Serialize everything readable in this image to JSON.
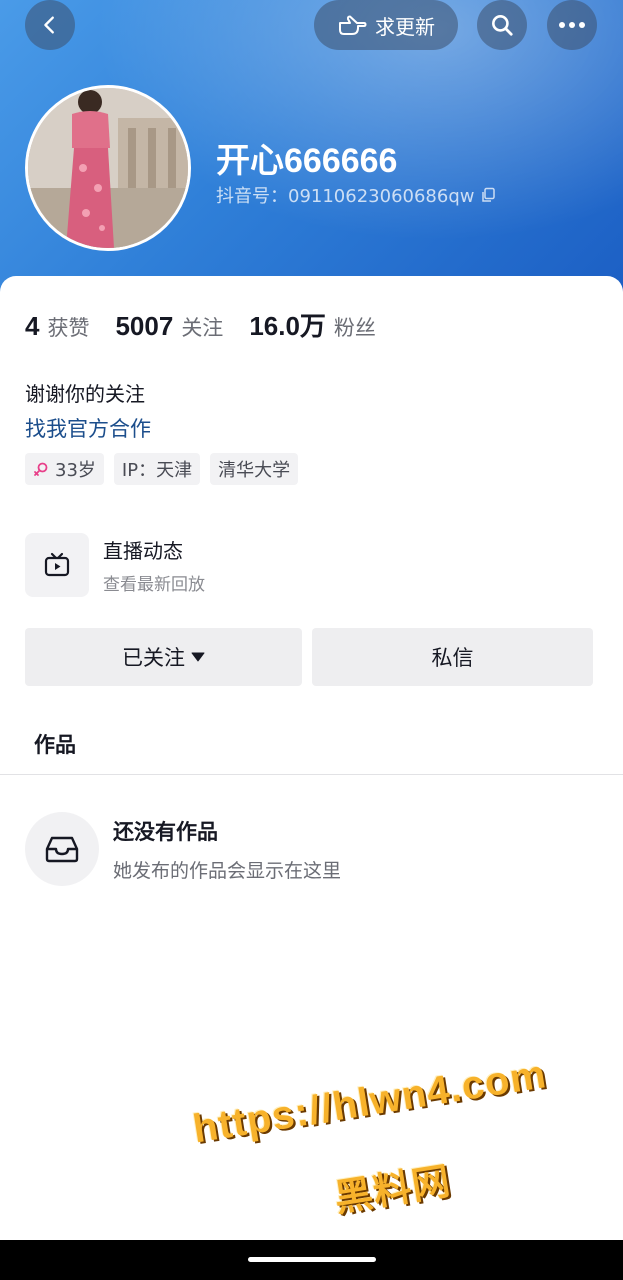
{
  "top_bar": {
    "back_icon": "chevron-left-icon",
    "update_label": "求更新",
    "update_icon": "pointing-hand-icon",
    "search_icon": "search-icon",
    "more_icon": "more-dots-icon"
  },
  "profile": {
    "nickname": "开心666666",
    "douyin_id": "抖音号：09110623060686qw",
    "copy_icon": "copy-icon"
  },
  "stats": [
    {
      "value": "4",
      "label": "获赞"
    },
    {
      "value": "5007",
      "label": "关注"
    },
    {
      "value": "16.0万",
      "label": "粉丝"
    }
  ],
  "bio": "谢谢你的关注",
  "link": "找我官方合作",
  "tags": [
    "33岁",
    "IP：天津",
    "清华大学"
  ],
  "tag_icons": [
    "female-icon"
  ],
  "live": {
    "title": "直播动态",
    "subtitle": "查看最新回放",
    "icon": "tv-icon"
  },
  "buttons": {
    "follow": "已关注",
    "message": "私信"
  },
  "tabs": {
    "works": "作品"
  },
  "empty": {
    "title": "还没有作品",
    "subtitle": "她发布的作品会显示在这里",
    "icon": "inbox-icon"
  },
  "watermark": {
    "line1": "https://hlwn4.com",
    "line2": "黑料网"
  },
  "colors": {
    "header_gradient_start": "#4a9be8",
    "header_gradient_end": "#1c5fc4",
    "link": "#1c4e8c",
    "watermark": "#f7b22b",
    "female_symbol": "#e8408a"
  }
}
